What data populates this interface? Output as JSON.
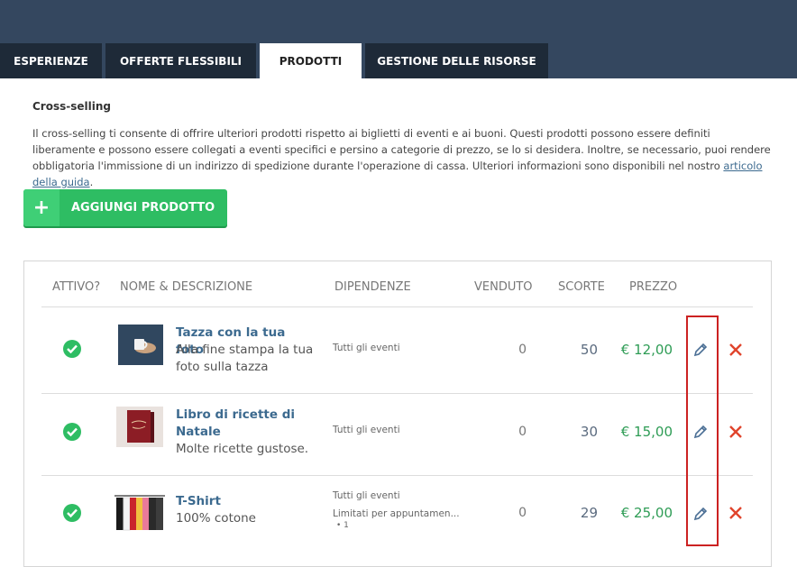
{
  "tabs": [
    {
      "label": "ESPERIENZE",
      "active": false
    },
    {
      "label": "OFFERTE FLESSIBILI",
      "active": false
    },
    {
      "label": "PRODOTTI",
      "active": true
    },
    {
      "label": "GESTIONE DELLE RISORSE",
      "active": false
    }
  ],
  "section": {
    "title": "Cross-selling",
    "description": "Il cross-selling ti consente di offrire ulteriori prodotti rispetto ai biglietti di eventi e ai buoni. Questi prodotti possono essere definiti liberamente e possono essere collegati a eventi specifici e persino a categorie di prezzo, se lo si desidera. Inoltre, se necessario, puoi rendere obbligatoria l'immissione di un indirizzo di spedizione durante l'operazione di cassa. Ulteriori informazioni sono disponibili nel nostro ",
    "link_text": "articolo della guida",
    "desc_end": "."
  },
  "add_button": {
    "icon": "+",
    "label": "AGGIUNGI PRODOTTO"
  },
  "table": {
    "headers": {
      "active": "ATTIVO?",
      "name": "NOME & DESCRIZIONE",
      "deps": "DIPENDENZE",
      "sold": "VENDUTO",
      "stock": "SCORTE",
      "price": "PREZZO"
    },
    "rows": [
      {
        "name": "Tazza con la tua foto",
        "description": "Alla fine stampa la tua foto sulla tazza",
        "deps": [
          "Tutti gli eventi"
        ],
        "deps_sub": "",
        "sold": "0",
        "stock": "50",
        "price": "€ 12,00",
        "active": true,
        "image": "mug-photo"
      },
      {
        "name": "Libro di ricette di Natale",
        "description": "Molte ricette gustose.",
        "deps": [
          "Tutti gli eventi"
        ],
        "deps_sub": "",
        "sold": "0",
        "stock": "30",
        "price": "€ 15,00",
        "active": true,
        "image": "recipe-book"
      },
      {
        "name": "T-Shirt",
        "description": "100% cotone",
        "deps": [
          "Tutti gli eventi",
          "Limitati per appuntamen..."
        ],
        "deps_sub": "• 1",
        "sold": "0",
        "stock": "29",
        "price": "€ 25,00",
        "active": true,
        "image": "tshirts-rack"
      }
    ]
  },
  "colors": {
    "header_bg": "#34475f",
    "tab_bg": "#1e2a38",
    "accent_green": "#2ebd63",
    "link_blue": "#3c6a8f",
    "delete_red": "#e0442c",
    "highlight_red": "#cc2222"
  }
}
